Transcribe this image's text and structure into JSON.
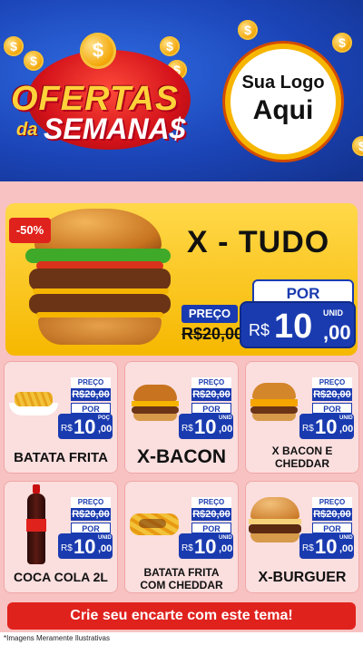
{
  "header": {
    "title_line1": "OFERTAS",
    "title_da": "da",
    "title_line2": "SEMANA$",
    "coin_symbol": "$",
    "logo_line1": "Sua Logo",
    "logo_line2": "Aqui"
  },
  "featured": {
    "discount": "-50%",
    "name": "X - TUDO",
    "preco_label": "PREÇO",
    "old_price": "R$20,00",
    "por_label": "POR",
    "unid_label": "UNID",
    "currency": "R$",
    "price_int": "10",
    "price_dec": ",00"
  },
  "products": [
    {
      "name": "BATATA FRITA",
      "preco_label": "PREÇO",
      "old_price": "R$20,00",
      "por_label": "POR",
      "unid_label": "POÇ",
      "currency": "R$",
      "price_int": "10",
      "price_dec": ",00"
    },
    {
      "name": "X-BACON",
      "preco_label": "PREÇO",
      "old_price": "R$20,00",
      "por_label": "POR",
      "unid_label": "UNID",
      "currency": "R$",
      "price_int": "10",
      "price_dec": ",00"
    },
    {
      "name": "X BACON E CHEDDAR",
      "preco_label": "PREÇO",
      "old_price": "R$20,00",
      "por_label": "POR",
      "unid_label": "UNID",
      "currency": "R$",
      "price_int": "10",
      "price_dec": ",00"
    },
    {
      "name": "COCA COLA 2L",
      "preco_label": "PREÇO",
      "old_price": "R$20,00",
      "por_label": "POR",
      "unid_label": "UNID",
      "currency": "R$",
      "price_int": "10",
      "price_dec": ",00"
    },
    {
      "name": "BATATA FRITA COM CHEDDAR",
      "preco_label": "PREÇO",
      "old_price": "R$20,00",
      "por_label": "POR",
      "unid_label": "UNID",
      "currency": "R$",
      "price_int": "10",
      "price_dec": ",00"
    },
    {
      "name": "X-BURGUER",
      "preco_label": "PREÇO",
      "old_price": "R$20,00",
      "por_label": "POR",
      "unid_label": "UNID",
      "currency": "R$",
      "price_int": "10",
      "price_dec": ",00"
    }
  ],
  "footer": {
    "cta": "Crie seu encarte com este tema!",
    "note": "*Imagens Meramente Ilustrativas"
  },
  "colors": {
    "header_blue": "#1b45b8",
    "accent_red": "#e0221d",
    "price_blue": "#1a3bb0",
    "featured_yellow": "#ffd84a"
  }
}
